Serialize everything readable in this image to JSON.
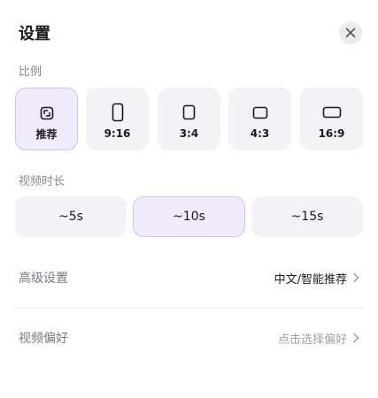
{
  "title": "设置",
  "ratio": {
    "label": "比例",
    "options": [
      {
        "label": "推荐",
        "icon": "auto-crop-icon",
        "selected": true
      },
      {
        "label": "9:16",
        "icon": "portrait-9-16-icon",
        "selected": false
      },
      {
        "label": "3:4",
        "icon": "portrait-3-4-icon",
        "selected": false
      },
      {
        "label": "4:3",
        "icon": "landscape-4-3-icon",
        "selected": false
      },
      {
        "label": "16:9",
        "icon": "landscape-16-9-icon",
        "selected": false
      }
    ]
  },
  "duration": {
    "label": "视频时长",
    "options": [
      {
        "label": "~5s",
        "selected": false
      },
      {
        "label": "~10s",
        "selected": true
      },
      {
        "label": "~15s",
        "selected": false
      }
    ]
  },
  "advanced": {
    "label": "高级设置",
    "value": "中文/智能推荐"
  },
  "preference": {
    "label": "视频偏好",
    "value": "点击选择偏好"
  },
  "colors": {
    "accent_bg": "#efebfb",
    "accent_border": "#cfc3f3",
    "card_bg": "#f3f3f5",
    "text_primary": "#1a1a1a",
    "text_secondary": "#8a8a8e"
  }
}
